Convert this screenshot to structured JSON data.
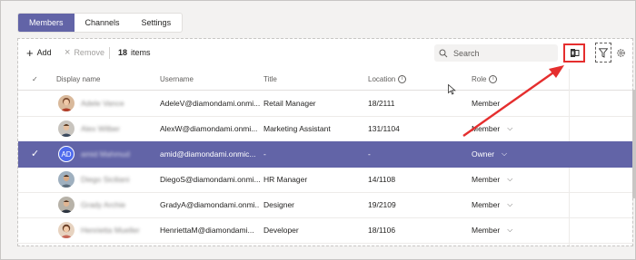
{
  "tabs": [
    {
      "label": "Members",
      "active": true
    },
    {
      "label": "Channels",
      "active": false
    },
    {
      "label": "Settings",
      "active": false
    }
  ],
  "toolbar": {
    "add_label": "Add",
    "remove_label": "Remove",
    "count_number": "18",
    "count_label": "items",
    "search_placeholder": "Search"
  },
  "columns": {
    "display_name": "Display name",
    "username": "Username",
    "title": "Title",
    "location": "Location",
    "role": "Role"
  },
  "rows": [
    {
      "name": "Adele Vance",
      "username": "AdeleV@diamondami.onmi...",
      "title": "Retail Manager",
      "location": "18/2111",
      "role": "Member",
      "has_dropdown": false,
      "selected": false
    },
    {
      "name": "Alex Wilber",
      "username": "AlexW@diamondami.onmi...",
      "title": "Marketing Assistant",
      "location": "131/1104",
      "role": "Member",
      "has_dropdown": true,
      "selected": false
    },
    {
      "name": "amid Mahmud",
      "initials": "AD",
      "username": "amid@diamondami.onmic...",
      "title": "-",
      "location": "-",
      "role": "Owner",
      "has_dropdown": true,
      "selected": true
    },
    {
      "name": "Diego Siciliani",
      "username": "DiegoS@diamondami.onmi...",
      "title": "HR Manager",
      "location": "14/1108",
      "role": "Member",
      "has_dropdown": true,
      "selected": false
    },
    {
      "name": "Grady Archie",
      "username": "GradyA@diamondami.onmi...",
      "title": "Designer",
      "location": "19/2109",
      "role": "Member",
      "has_dropdown": true,
      "selected": false
    },
    {
      "name": "Henrietta Mueller",
      "username": "HenriettaM@diamondami...",
      "title": "Developer",
      "location": "18/1106",
      "role": "Member",
      "has_dropdown": true,
      "selected": false
    }
  ],
  "colors": {
    "accent": "#6264a7",
    "highlight": "#e52e2e"
  },
  "icons": [
    "plus-icon",
    "close-icon",
    "search-icon",
    "office-icon",
    "filter-icon",
    "gear-icon",
    "info-icon",
    "chevron-down-icon",
    "check-icon"
  ]
}
